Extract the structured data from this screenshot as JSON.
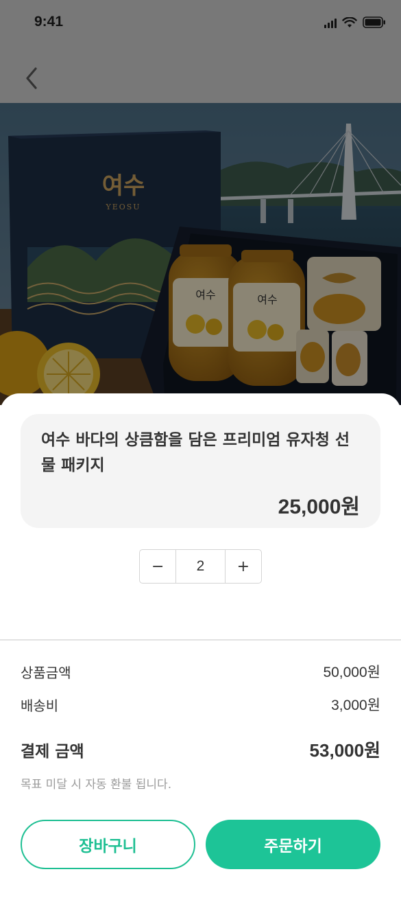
{
  "status_bar": {
    "time": "9:41"
  },
  "icons": {
    "back": "chevron-left-icon",
    "signal": "cellular-signal-icon",
    "wifi": "wifi-icon",
    "battery": "battery-icon",
    "minus": "minus-icon",
    "plus": "plus-icon"
  },
  "product": {
    "image_alt": "여수 유자청 선물세트",
    "box_logo": "여수",
    "box_sub": "YEOSU",
    "jar_label": "여수",
    "title": "여수 바다의 상큼함을 담은 프리미엄 유자청 선물 패키지",
    "price": "25,000원"
  },
  "quantity": {
    "minus_label": "−",
    "value": "2",
    "plus_label": "+"
  },
  "summary": {
    "subtotal_label": "상품금액",
    "subtotal_value": "50,000원",
    "shipping_label": "배송비",
    "shipping_value": "3,000원",
    "total_label": "결제 금액",
    "total_value": "53,000원",
    "notice": "목표 미달 시 자동 환불 됩니다."
  },
  "actions": {
    "cart_label": "장바구니",
    "order_label": "주문하기"
  },
  "colors": {
    "accent": "#1dc497",
    "dim_overlay": "#787878",
    "card_bg": "#f4f4f4"
  }
}
